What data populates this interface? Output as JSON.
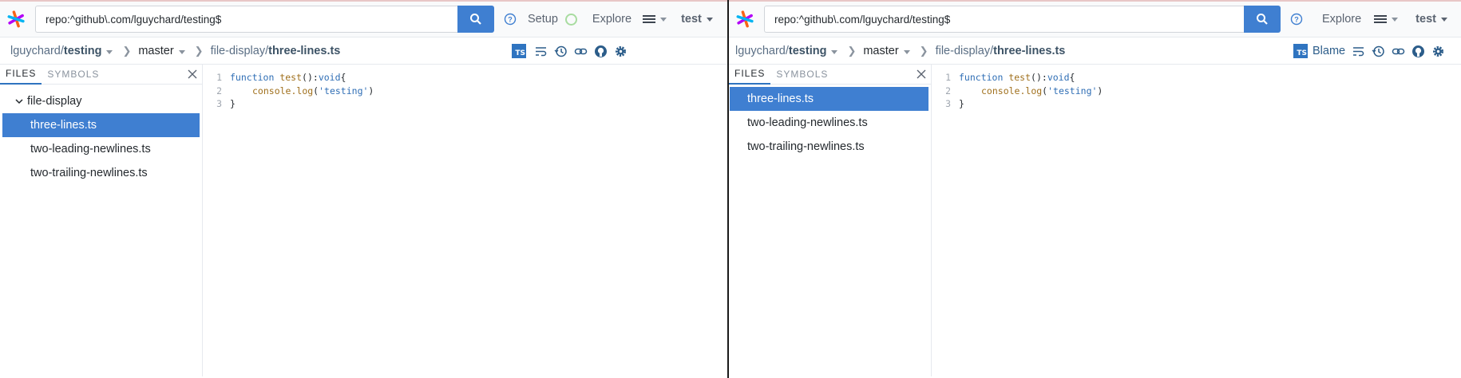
{
  "left": {
    "search": {
      "value": "repo:^github\\.com/lguychard/testing$"
    },
    "nav": {
      "setup": "Setup",
      "explore": "Explore",
      "user": "test"
    },
    "breadcrumb": {
      "owner": "lguychard/",
      "repo": "testing",
      "branch": "master",
      "dir": "file-display",
      "slash": "/",
      "file": "three-lines.ts"
    },
    "tabs": {
      "files": "FILES",
      "symbols": "SYMBOLS"
    },
    "tree": {
      "folder": "file-display",
      "files": [
        "three-lines.ts",
        "two-leading-newlines.ts",
        "two-trailing-newlines.ts"
      ],
      "active_index": 0
    },
    "ts_badge": "TS"
  },
  "right": {
    "search": {
      "value": "repo:^github\\.com/lguychard/testing$"
    },
    "nav": {
      "explore": "Explore",
      "user": "test"
    },
    "breadcrumb": {
      "owner": "lguychard/",
      "repo": "testing",
      "branch": "master",
      "dir": "file-display",
      "slash": "/",
      "file": "three-lines.ts"
    },
    "blame": "Blame",
    "tabs": {
      "files": "FILES",
      "symbols": "SYMBOLS"
    },
    "tree": {
      "files": [
        "three-lines.ts",
        "two-leading-newlines.ts",
        "two-trailing-newlines.ts"
      ],
      "active_index": 0
    },
    "ts_badge": "TS"
  },
  "code": {
    "line_numbers": [
      "1",
      "2",
      "3"
    ],
    "l1_kw": "function",
    "l1_fn": "test",
    "l1_mid": "(): ",
    "l1_type": "void",
    "l1_end": " {",
    "l2_obj": "console.",
    "l2_fn": "log",
    "l2_open": "(",
    "l2_str": "'testing'",
    "l2_close": ")",
    "l3": "}"
  },
  "colors": {
    "accent": "#3f7fd1",
    "ts_blue": "#2f74c0",
    "keyword": "#2f6eb5",
    "function": "#a0701d"
  }
}
